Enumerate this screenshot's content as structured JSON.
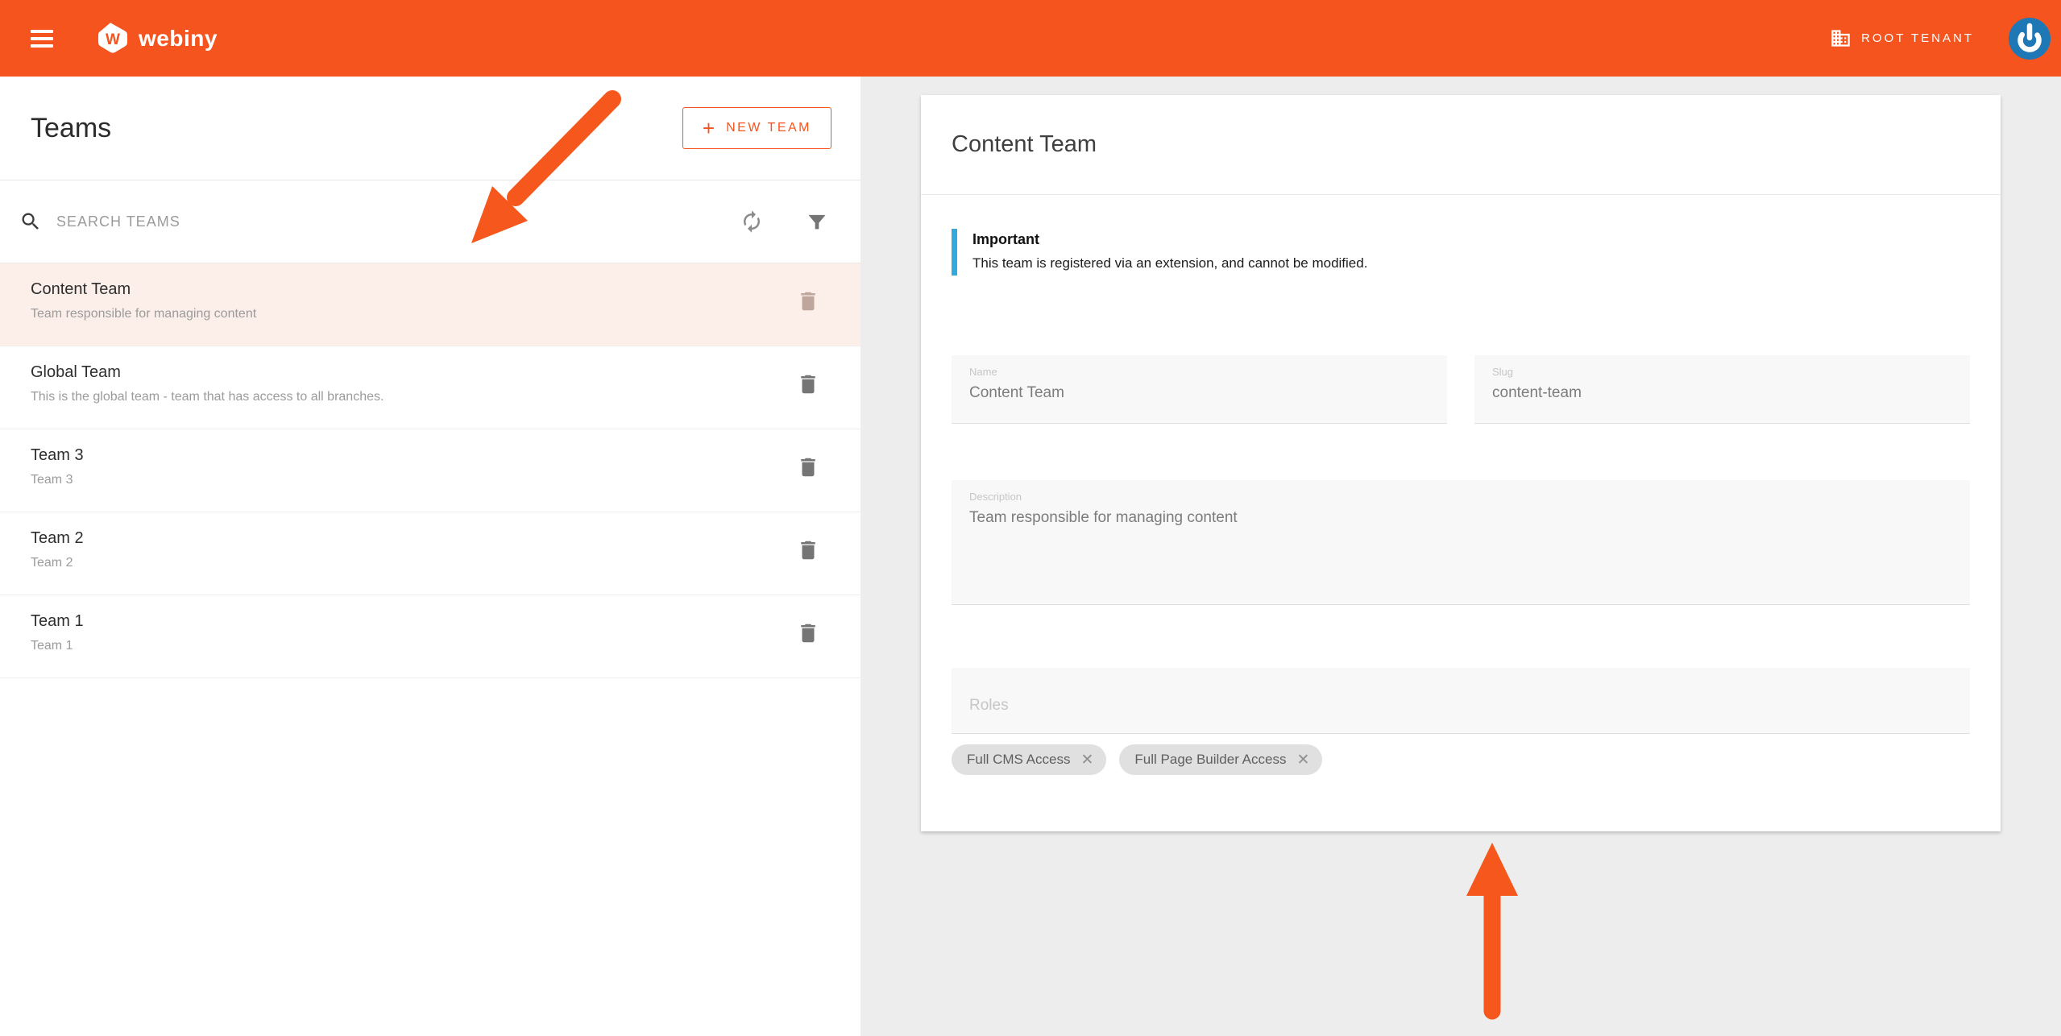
{
  "theme": {
    "accent": "#F5541F",
    "alert_blue": "#33A9DC",
    "avatar_blue": "#1E78B6",
    "selected_row_bg": "#FCEFE9",
    "arrow_color": "#F5571D"
  },
  "icons": {
    "plus": "+",
    "close": "✕"
  },
  "header": {
    "logo_letter": "W",
    "logo_text": "webiny",
    "tenant_label": "ROOT TENANT"
  },
  "left_panel": {
    "title": "Teams",
    "new_team_button": "NEW TEAM",
    "search_placeholder": "SEARCH TEAMS",
    "teams": [
      {
        "name": "Content Team",
        "description": "Team responsible for managing content",
        "selected": true
      },
      {
        "name": "Global Team",
        "description": "This is the global team - team that has access to all branches.",
        "selected": false
      },
      {
        "name": "Team 3",
        "description": "Team 3",
        "selected": false
      },
      {
        "name": "Team 2",
        "description": "Team 2",
        "selected": false
      },
      {
        "name": "Team 1",
        "description": "Team 1",
        "selected": false
      }
    ]
  },
  "detail": {
    "title": "Content Team",
    "alert": {
      "title": "Important",
      "message": "This team is registered via an extension, and cannot be modified."
    },
    "fields": {
      "name": {
        "label": "Name",
        "value": "Content Team"
      },
      "slug": {
        "label": "Slug",
        "value": "content-team"
      },
      "description": {
        "label": "Description",
        "value": "Team responsible for managing content"
      },
      "roles": {
        "label": "Roles"
      }
    },
    "roles_chips": [
      "Full CMS Access",
      "Full Page Builder Access"
    ]
  }
}
